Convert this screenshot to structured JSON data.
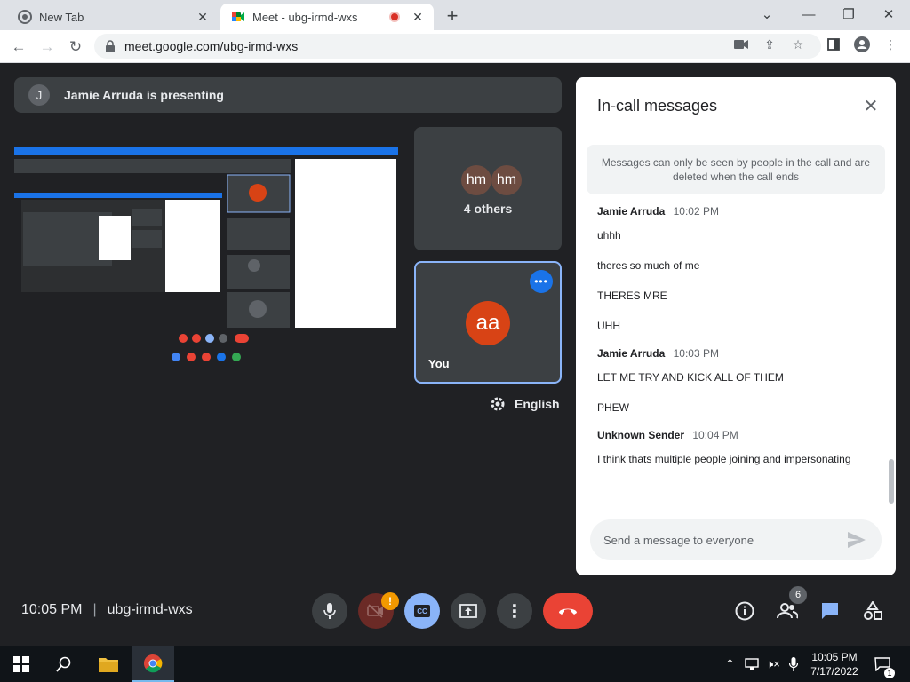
{
  "browser": {
    "tabs": [
      {
        "title": "New Tab",
        "favicon": "chrome-icon"
      },
      {
        "title": "Meet - ubg-irmd-wxs",
        "favicon": "google-meet-icon",
        "recording": true
      }
    ],
    "url": "meet.google.com/ubg-irmd-wxs"
  },
  "meet": {
    "presenting_avatar": "J",
    "presenting_text": "Jamie Arruda is presenting",
    "others_avatars": [
      "hm",
      "hm"
    ],
    "others_label": "4 others",
    "self_avatar": "aa",
    "self_label": "You",
    "captions_language": "English",
    "time": "10:05 PM",
    "meeting_code": "ubg-irmd-wxs",
    "people_count": "6",
    "camera_warning": "!"
  },
  "chat": {
    "title": "In-call messages",
    "notice": "Messages can only be seen by people in the call and are deleted when the call ends",
    "groups": [
      {
        "sender": "Jamie Arruda",
        "time": "10:02 PM",
        "messages": [
          "uhhh",
          "theres  so much of me",
          "THERES MRE",
          "UHH"
        ]
      },
      {
        "sender": "Jamie Arruda",
        "time": "10:03 PM",
        "messages": [
          "LET ME TRY AND KICK ALL OF THEM",
          "PHEW"
        ]
      },
      {
        "sender": "Unknown Sender",
        "time": "10:04 PM",
        "messages": [
          "I think thats multiple people joining and impersonating"
        ]
      }
    ],
    "input_placeholder": "Send a message to everyone"
  },
  "taskbar": {
    "time": "10:05 PM",
    "date": "7/17/2022",
    "notifications": "1"
  },
  "colors": {
    "accent": "#1a73e8",
    "end_call": "#ea4335",
    "meet_bg": "#202124",
    "tile_bg": "#3c4043"
  }
}
